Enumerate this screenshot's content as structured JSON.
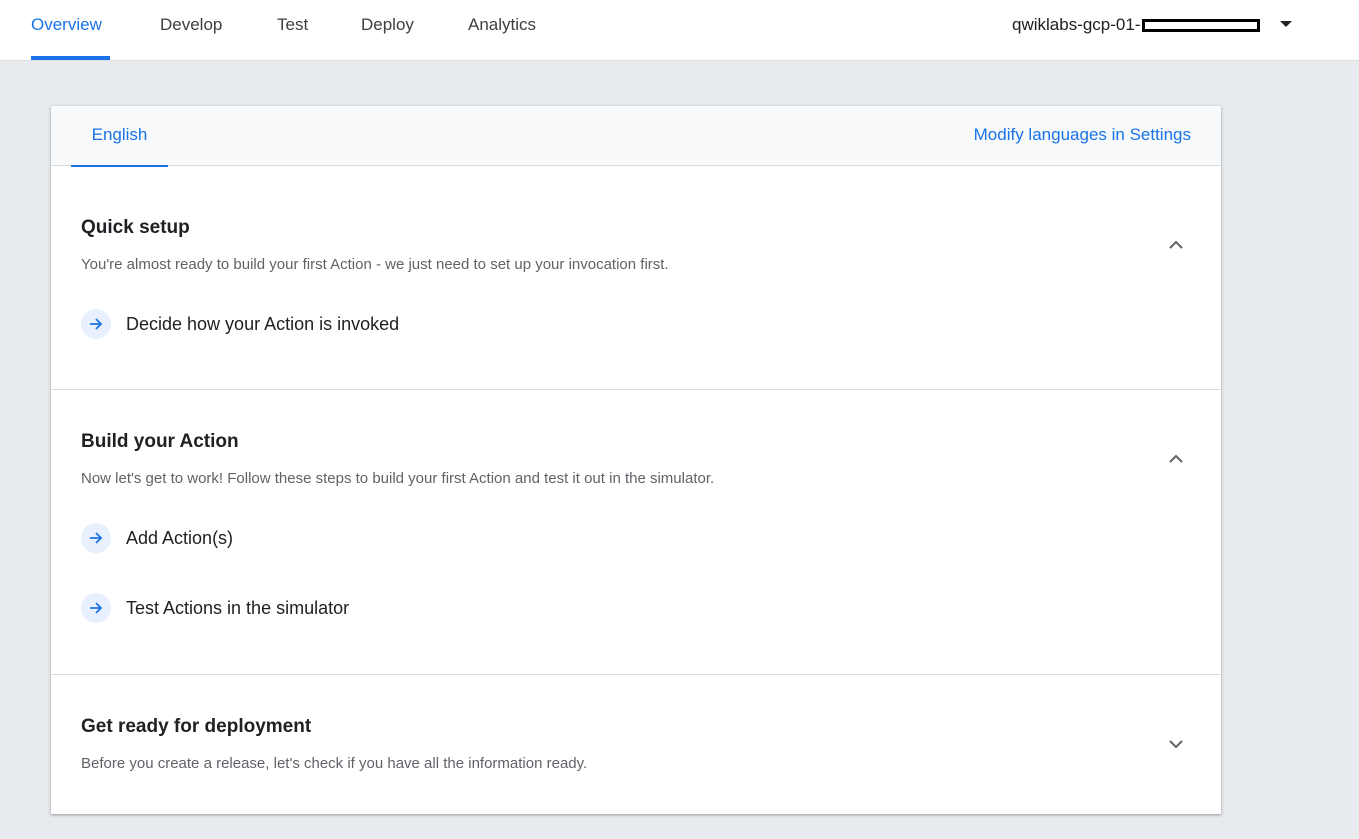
{
  "nav": {
    "tabs": [
      "Overview",
      "Develop",
      "Test",
      "Deploy",
      "Analytics"
    ],
    "active_tab": "Overview",
    "project_prefix": "qwiklabs-gcp-01-"
  },
  "card": {
    "language_tab": "English",
    "modify_link": "Modify languages in Settings",
    "sections": [
      {
        "title": "Quick setup",
        "description": "You're almost ready to build your first Action - we just need to set up your invocation first.",
        "expanded": true,
        "steps": [
          "Decide how your Action is invoked"
        ]
      },
      {
        "title": "Build your Action",
        "description": "Now let's get to work! Follow these steps to build your first Action and test it out in the simulator.",
        "expanded": true,
        "steps": [
          "Add Action(s)",
          "Test Actions in the simulator"
        ]
      },
      {
        "title": "Get ready for deployment",
        "description": "Before you create a release, let's check if you have all the information ready.",
        "expanded": false,
        "steps": []
      }
    ]
  },
  "colors": {
    "accent": "#1a73e8",
    "page_bg": "#e9ecef",
    "step_icon_bg": "#e8f0fe"
  },
  "icons": {
    "step": "arrow-right-icon",
    "expanded": "chevron-up-icon",
    "collapsed": "chevron-down-icon",
    "project_menu": "caret-down-icon"
  }
}
